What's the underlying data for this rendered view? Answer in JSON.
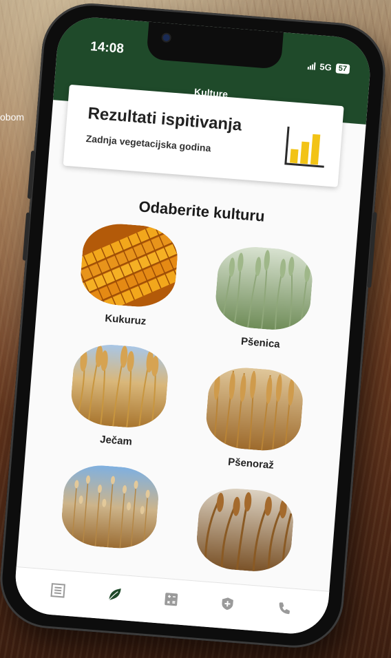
{
  "background": {
    "partial_text": "obom"
  },
  "status_bar": {
    "time": "14:08",
    "network": "5G",
    "battery": "57"
  },
  "header": {
    "title": "Kulture"
  },
  "results_card": {
    "title": "Rezultati ispitivanja",
    "subtitle": "Zadnja vegetacijska godina",
    "icon": "bar-chart-icon"
  },
  "section": {
    "title": "Odaberite kulturu"
  },
  "crops": [
    {
      "label": "Kukuruz"
    },
    {
      "label": "Pšenica"
    },
    {
      "label": "Ječam"
    },
    {
      "label": "Pšenoraž"
    },
    {
      "label": ""
    },
    {
      "label": ""
    }
  ],
  "bottom_nav": [
    {
      "icon": "list-icon"
    },
    {
      "icon": "leaf-icon"
    },
    {
      "icon": "calculator-icon"
    },
    {
      "icon": "shield-plus-icon"
    },
    {
      "icon": "phone-icon"
    }
  ],
  "colors": {
    "header": "#1f4a2a",
    "chart_bars": "#f2c316",
    "background_wheat": "#6a3a20"
  }
}
